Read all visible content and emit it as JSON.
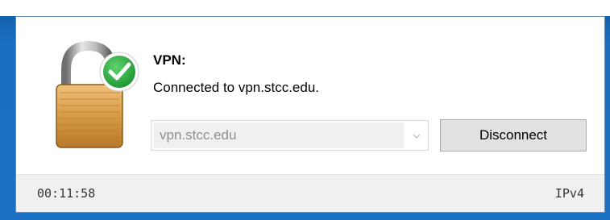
{
  "dialog": {
    "title": "VPN:",
    "status_text": "Connected to vpn.stcc.edu."
  },
  "server_select": {
    "value": "vpn.stcc.edu"
  },
  "buttons": {
    "disconnect_label": "Disconnect"
  },
  "status_bar": {
    "elapsed_time": "00:11:58",
    "protocol": "IPv4"
  },
  "icons": {
    "main": "lock-connected-icon",
    "badge": "checkmark-icon",
    "dropdown": "chevron-down-icon"
  },
  "colors": {
    "accent_blue": "#1b70c4",
    "check_green": "#22a83a",
    "lock_gold": "#d7a04a"
  }
}
